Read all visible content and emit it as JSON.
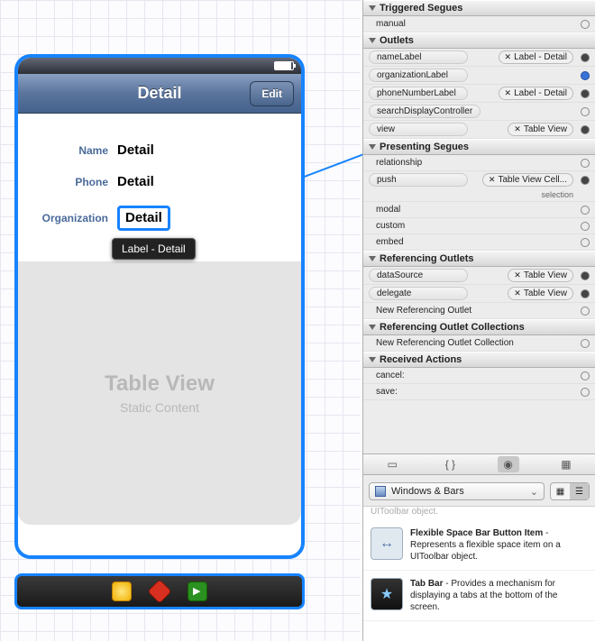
{
  "phone": {
    "nav_title": "Detail",
    "edit_button": "Edit",
    "rows": [
      {
        "label": "Name",
        "value": "Detail"
      },
      {
        "label": "Phone",
        "value": "Detail"
      },
      {
        "label": "Organization",
        "value": "Detail"
      }
    ],
    "tooltip": "Label - Detail",
    "tableview_title": "Table View",
    "tableview_subtitle": "Static Content"
  },
  "inspector": {
    "sections": {
      "triggered_segues": "Triggered Segues",
      "outlets": "Outlets",
      "presenting_segues": "Presenting Segues",
      "referencing_outlets": "Referencing Outlets",
      "referencing_outlet_collections": "Referencing Outlet Collections",
      "received_actions": "Received Actions"
    },
    "triggered": [
      {
        "label": "manual"
      }
    ],
    "outlets": [
      {
        "label": "nameLabel",
        "conn": "Label - Detail",
        "filled": true
      },
      {
        "label": "organizationLabel",
        "conn": "",
        "filled": true,
        "selected": true
      },
      {
        "label": "phoneNumberLabel",
        "conn": "Label - Detail",
        "filled": true
      },
      {
        "label": "searchDisplayController",
        "conn": "",
        "filled": false
      },
      {
        "label": "view",
        "conn": "Table View",
        "filled": true
      }
    ],
    "presenting": {
      "relationship": "relationship",
      "push": "push",
      "push_conn": "Table View Cell...",
      "push_sub": "selection",
      "modal": "modal",
      "custom": "custom",
      "embed": "embed"
    },
    "referencing": [
      {
        "label": "dataSource",
        "conn": "Table View"
      },
      {
        "label": "delegate",
        "conn": "Table View"
      },
      {
        "label_plain": "New Referencing Outlet"
      }
    ],
    "ref_collections": [
      {
        "label_plain": "New Referencing Outlet Collection"
      }
    ],
    "actions": [
      {
        "label": "cancel:"
      },
      {
        "label": "save:"
      }
    ]
  },
  "library": {
    "combo": "Windows & Bars",
    "trunc": "UIToolbar object.",
    "items": [
      {
        "title": "Flexible Space Bar Button Item",
        "desc": "Represents a flexible space item on a UIToolbar object.",
        "icon": "↔"
      },
      {
        "title": "Tab Bar",
        "desc": "Provides a mechanism for displaying a tabs at the bottom of the screen.",
        "icon": "★"
      }
    ]
  }
}
